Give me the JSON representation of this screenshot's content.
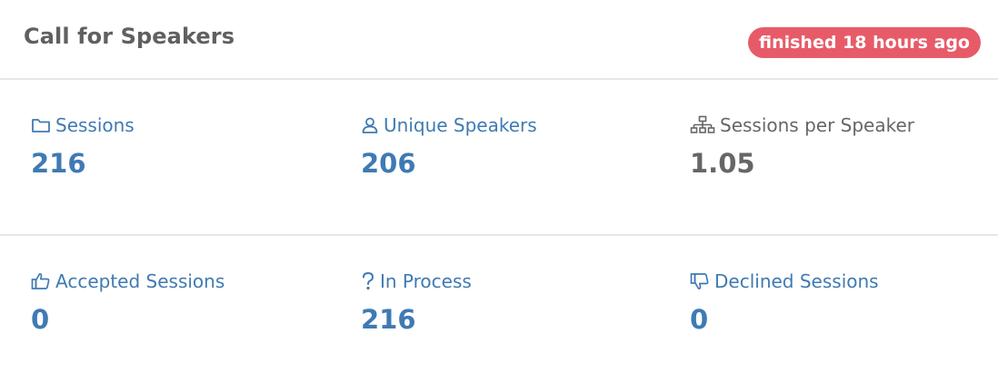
{
  "header": {
    "title": "Call for Speakers",
    "status_badge": "finished 18 hours ago"
  },
  "colors": {
    "accent": "#3f7ab3",
    "badge": "#e75b69",
    "muted": "#666666"
  },
  "stats_row_1": [
    {
      "label": "Sessions",
      "value": "216",
      "icon": "folder-icon"
    },
    {
      "label": "Unique Speakers",
      "value": "206",
      "icon": "user-icon"
    },
    {
      "label": "Sessions per Speaker",
      "value": "1.05",
      "icon": "sitemap-icon"
    }
  ],
  "stats_row_2": [
    {
      "label": "Accepted Sessions",
      "value": "0",
      "icon": "thumbs-up-icon"
    },
    {
      "label": "In Process",
      "value": "216",
      "icon": "question-icon"
    },
    {
      "label": "Declined Sessions",
      "value": "0",
      "icon": "thumbs-down-icon"
    }
  ]
}
